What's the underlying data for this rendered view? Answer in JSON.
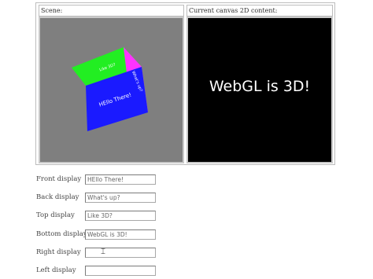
{
  "scene_panel": {
    "header": "Scene:",
    "cube_faces": {
      "front": "HEllo There!",
      "top": "Like 3D?",
      "right": "What's up?"
    },
    "colors": {
      "front": "#1a1aff",
      "top": "#22ee22",
      "right": "#ff33ff",
      "background": "#7f7f7f"
    }
  },
  "canvas_panel": {
    "header": "Current canvas 2D content:",
    "text": "WebGL is 3D!",
    "colors": {
      "background": "#000000",
      "text": "#ffffff"
    }
  },
  "form": {
    "front": {
      "label": "Front display",
      "value": "HEllo There!"
    },
    "back": {
      "label": "Back display",
      "value": "What's up?"
    },
    "top": {
      "label": "Top display",
      "value": "Like 3D?"
    },
    "bottom": {
      "label": "Bottom display",
      "value": "WebGL is 3D!"
    },
    "right": {
      "label": "Right display",
      "value": ""
    },
    "left": {
      "label": "Left display",
      "value": ""
    }
  },
  "cursor_icon": "i-beam-cursor-icon"
}
